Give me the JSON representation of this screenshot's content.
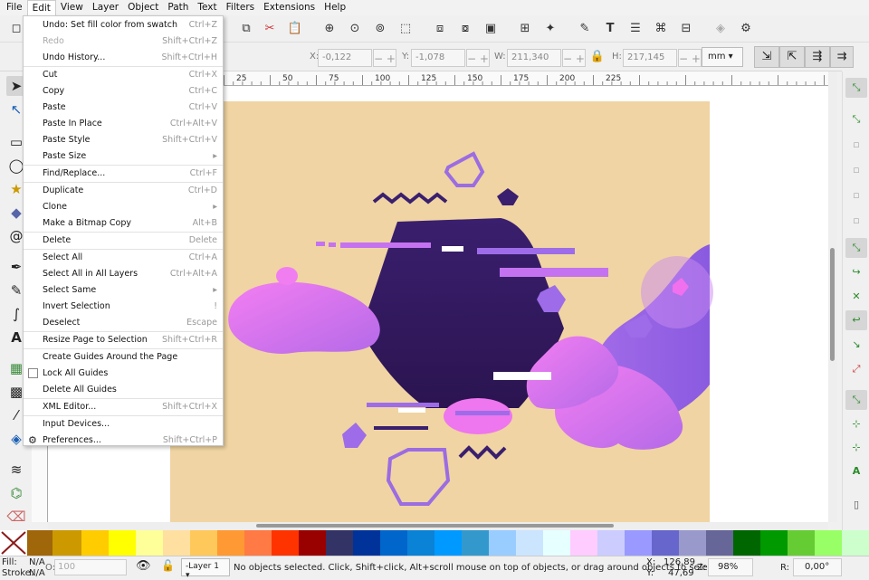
{
  "menubar": [
    "File",
    "Edit",
    "View",
    "Layer",
    "Object",
    "Path",
    "Text",
    "Filters",
    "Extensions",
    "Help"
  ],
  "active_menu": "Edit",
  "edit_menu": [
    {
      "label": "Undo: Set fill color from swatch",
      "shortcut": "Ctrl+Z"
    },
    {
      "label": "Redo",
      "shortcut": "Shift+Ctrl+Z",
      "disabled": true
    },
    {
      "label": "Undo History...",
      "shortcut": "Shift+Ctrl+H"
    },
    {
      "sep": true
    },
    {
      "label": "Cut",
      "shortcut": "Ctrl+X"
    },
    {
      "label": "Copy",
      "shortcut": "Ctrl+C"
    },
    {
      "label": "Paste",
      "shortcut": "Ctrl+V"
    },
    {
      "label": "Paste In Place",
      "shortcut": "Ctrl+Alt+V"
    },
    {
      "label": "Paste Style",
      "shortcut": "Shift+Ctrl+V"
    },
    {
      "label": "Paste Size",
      "shortcut": "▸"
    },
    {
      "sep": true
    },
    {
      "label": "Find/Replace...",
      "shortcut": "Ctrl+F"
    },
    {
      "sep": true
    },
    {
      "label": "Duplicate",
      "shortcut": "Ctrl+D"
    },
    {
      "label": "Clone",
      "shortcut": "▸"
    },
    {
      "label": "Make a Bitmap Copy",
      "shortcut": "Alt+B"
    },
    {
      "sep": true
    },
    {
      "label": "Delete",
      "shortcut": "Delete"
    },
    {
      "sep": true
    },
    {
      "label": "Select All",
      "shortcut": "Ctrl+A"
    },
    {
      "label": "Select All in All Layers",
      "shortcut": "Ctrl+Alt+A"
    },
    {
      "label": "Select Same",
      "shortcut": "▸"
    },
    {
      "label": "Invert Selection",
      "shortcut": "!"
    },
    {
      "label": "Deselect",
      "shortcut": "Escape"
    },
    {
      "sep": true
    },
    {
      "label": "Resize Page to Selection",
      "shortcut": "Shift+Ctrl+R"
    },
    {
      "sep": true
    },
    {
      "label": "Create Guides Around the Page",
      "shortcut": ""
    },
    {
      "label": "Lock All Guides",
      "shortcut": "",
      "checkbox": true
    },
    {
      "label": "Delete All Guides",
      "shortcut": ""
    },
    {
      "sep": true
    },
    {
      "label": "XML Editor...",
      "shortcut": "Shift+Ctrl+X"
    },
    {
      "sep": true
    },
    {
      "label": "Input Devices...",
      "shortcut": ""
    },
    {
      "label": "Preferences...",
      "shortcut": "Shift+Ctrl+P"
    }
  ],
  "controls": {
    "x_label": "X:",
    "x_value": "-0,122",
    "y_label": "Y:",
    "y_value": "-1,078",
    "w_label": "W:",
    "w_value": "211,340",
    "h_label": "H:",
    "h_value": "217,145",
    "unit": "mm"
  },
  "ruler_top": [
    "25",
    "50",
    "75",
    "100",
    "125",
    "150",
    "175",
    "200",
    "225"
  ],
  "status": {
    "fill_label": "Fill:",
    "fill_value": "N/A",
    "stroke_label": "Stroke:",
    "stroke_value": "N/A",
    "opacity_label": "O:",
    "opacity_value": "100",
    "layer": "-Layer 1",
    "message": "No objects selected. Click, Shift+click, Alt+scroll mouse on top of objects, or drag around objects to select.",
    "x_label": "X:",
    "x_value": "126,89",
    "y_label": "Y:",
    "y_value": "47,69",
    "zoom_label": "Z:",
    "zoom_value": "98%",
    "rot_label": "R:",
    "rot_value": "0,00°"
  },
  "palette": [
    "#a0660a",
    "#cc9900",
    "#ffcc00",
    "#ffff00",
    "#ffff99",
    "#ffe0a0",
    "#ffc85a",
    "#ff9933",
    "#ff7a44",
    "#ff3300",
    "#990000",
    "#333366",
    "#003399",
    "#0066cc",
    "#0a82d6",
    "#0099ff",
    "#3399cc",
    "#99ccff",
    "#cce5ff",
    "#e6ffff",
    "#ffccff",
    "#ccccff",
    "#9999ff",
    "#6666cc",
    "#9999cc",
    "#666699",
    "#006600",
    "#009900",
    "#66cc33",
    "#99ff66",
    "#ccffcc"
  ],
  "colors": {
    "page": "#f0d4a3",
    "hex_dark": "#3a1f6e",
    "pink": "#f075f0",
    "purple": "#9e6ce8"
  }
}
